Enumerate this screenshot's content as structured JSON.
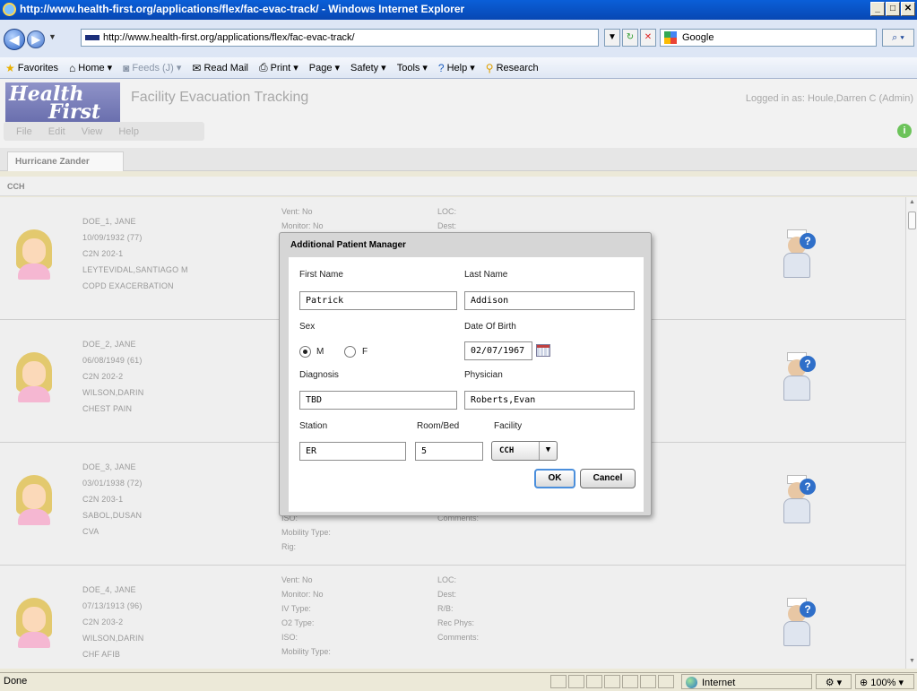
{
  "browser": {
    "title": "http://www.health-first.org/applications/flex/fac-evac-track/ - Windows Internet Explorer",
    "url": "http://www.health-first.org/applications/flex/fac-evac-track/",
    "search_placeholder": "Google",
    "commands": {
      "favorites": "Favorites",
      "home": "Home",
      "feeds": "Feeds (J)",
      "read_mail": "Read Mail",
      "print": "Print",
      "page": "Page",
      "safety": "Safety",
      "tools": "Tools",
      "help": "Help",
      "research": "Research"
    },
    "status": {
      "text": "Done",
      "zone": "Internet",
      "zoom": "100%"
    }
  },
  "app": {
    "logo_line1": "Health",
    "logo_line2": "First",
    "title": "Facility Evacuation Tracking",
    "logged_in": "Logged in as: Houle,Darren C (Admin)",
    "menu": [
      "File",
      "Edit",
      "View",
      "Help"
    ],
    "tab": "Hurricane Zander",
    "section": "CCH"
  },
  "patients": [
    {
      "name": "DOE_1, JANE",
      "dob": "10/09/1932 (77)",
      "room": "C2N 202-1",
      "physician": "LEYTEVIDAL,SANTIAGO M",
      "diagnosis": "COPD EXACERBATION",
      "col2": [
        "Vent: No",
        "Monitor: No"
      ],
      "col3": [
        "LOC:",
        "Dest:"
      ]
    },
    {
      "name": "DOE_2, JANE",
      "dob": "06/08/1949 (61)",
      "room": "C2N 202-2",
      "physician": "WILSON,DARIN",
      "diagnosis": "CHEST PAIN",
      "col2": [],
      "col3": []
    },
    {
      "name": "DOE_3, JANE",
      "dob": "03/01/1938 (72)",
      "room": "C2N 203-1",
      "physician": "SABOL,DUSAN",
      "diagnosis": "CVA",
      "col2": [
        "",
        "",
        "",
        "",
        "ISO:",
        "Mobility Type:",
        "Rig:"
      ],
      "col3": [
        "",
        "",
        "",
        "",
        "Comments:"
      ]
    },
    {
      "name": "DOE_4, JANE",
      "dob": "07/13/1913 (96)",
      "room": "C2N 203-2",
      "physician": "WILSON,DARIN",
      "diagnosis": "CHF AFIB",
      "col2": [
        "Vent: No",
        "Monitor: No",
        "IV Type:",
        "O2 Type:",
        "ISO:",
        "Mobility Type:"
      ],
      "col3": [
        "LOC:",
        "Dest:",
        "R/B:",
        "Rec Phys:",
        "Comments:"
      ]
    }
  ],
  "dialog": {
    "title": "Additional Patient Manager",
    "first_name_label": "First Name",
    "first_name": "Patrick",
    "last_name_label": "Last Name",
    "last_name": "Addison",
    "sex_label": "Sex",
    "sex_m": "M",
    "sex_f": "F",
    "sex_selected": "M",
    "dob_label": "Date Of Birth",
    "dob": "02/07/1967",
    "diagnosis_label": "Diagnosis",
    "diagnosis": "TBD",
    "physician_label": "Physician",
    "physician": "Roberts,Evan",
    "station_label": "Station",
    "station": "ER",
    "roombed_label": "Room/Bed",
    "roombed": "5",
    "facility_label": "Facility",
    "facility": "CCH",
    "ok": "OK",
    "cancel": "Cancel"
  }
}
